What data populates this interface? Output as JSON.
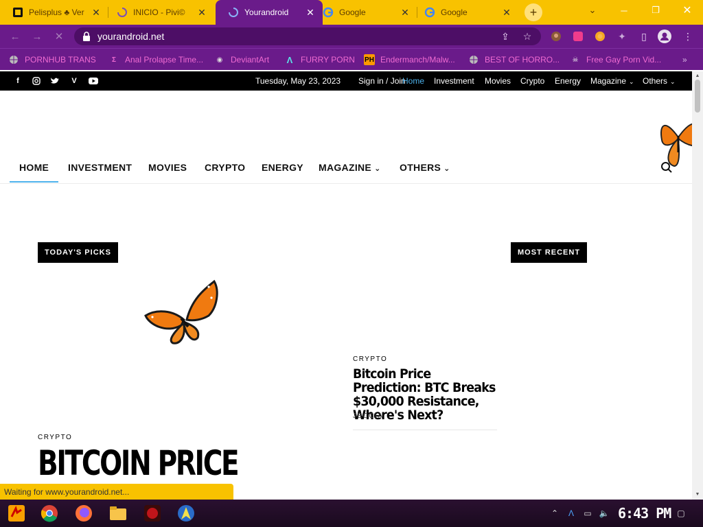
{
  "browser": {
    "tabs": [
      {
        "title": "Pelisplus ♣ Ver",
        "icon": "pelisplus-icon",
        "active": false
      },
      {
        "title": "INICIO - Pivi©",
        "icon": "loading-spinner-icon",
        "active": false
      },
      {
        "title": "Yourandroid",
        "icon": "loading-spinner-icon",
        "active": true
      },
      {
        "title": "Google",
        "icon": "google-icon",
        "active": false
      },
      {
        "title": "Google",
        "icon": "google-icon",
        "active": false
      }
    ],
    "url": "yourandroid.net",
    "bookmarks": [
      {
        "label": "PORNHUB TRANS",
        "icon": "globe-icon"
      },
      {
        "label": "Anal Prolapse Time...",
        "icon": "bracket-icon"
      },
      {
        "label": "DeviantArt",
        "icon": "deviantart-icon"
      },
      {
        "label": "FURRY PORN",
        "icon": "a-logo-icon"
      },
      {
        "label": "Endermanch/Malw...",
        "icon": "ph-icon"
      },
      {
        "label": "BEST OF HORRO...",
        "icon": "globe-icon"
      },
      {
        "label": "Free Gay Porn Vid...",
        "icon": "skull-icon"
      }
    ],
    "overflow_label": "»",
    "status_text": "Waiting for www.yourandroid.net..."
  },
  "site": {
    "date": "Tuesday, May 23, 2023",
    "signin": "Sign in / Join",
    "top_nav": [
      "Home",
      "Investment",
      "Movies",
      "Crypto",
      "Energy",
      "Magazine",
      "Others"
    ],
    "main_nav": [
      "HOME",
      "INVESTMENT",
      "MOVIES",
      "CRYPTO",
      "ENERGY",
      "MAGAZINE",
      "OTHERS"
    ],
    "social_icons": [
      "facebook-icon",
      "instagram-icon",
      "twitter-icon",
      "vimeo-icon",
      "youtube-icon"
    ],
    "todays_picks_label": "TODAY'S PICKS",
    "most_recent_label": "MOST RECENT",
    "recent_article": {
      "category": "CRYPTO",
      "title": "Bitcoin Price Prediction: BTC Breaks $30,000 Resistance, Where's Next?",
      "author": "JECCIA"
    },
    "featured_article": {
      "category": "CRYPTO",
      "title": "BITCOIN PRICE"
    }
  },
  "taskbar": {
    "clock": "6:43 PM"
  },
  "colors": {
    "tabstrip": "#f8c200",
    "toolbar": "#6a1b8a",
    "bookmark_text": "#f06bd2",
    "accent": "#4db2ec"
  }
}
